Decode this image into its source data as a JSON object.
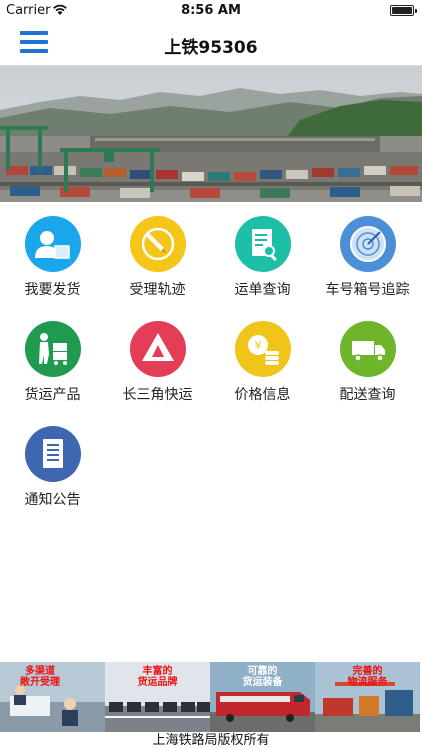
{
  "status_bar": {
    "carrier": "Carrier",
    "time": "8:56 AM"
  },
  "nav": {
    "title": "上铁95306"
  },
  "grid": [
    {
      "label": "我要发货",
      "icon": "person-box-icon",
      "color": "#1aa6ea"
    },
    {
      "label": "受理轨迹",
      "icon": "pen-circle-icon",
      "color": "#f5c518"
    },
    {
      "label": "运单查询",
      "icon": "document-search-icon",
      "color": "#1dbfa6"
    },
    {
      "label": "车号箱号追踪",
      "icon": "radar-icon",
      "color": "#4d8fd6"
    },
    {
      "label": "货运产品",
      "icon": "porter-cart-icon",
      "color": "#1f9a4e"
    },
    {
      "label": "长三角快运",
      "icon": "triangle-logo-icon",
      "color": "#e33d57"
    },
    {
      "label": "价格信息",
      "icon": "coins-icon",
      "color": "#f0c419"
    },
    {
      "label": "配送查询",
      "icon": "truck-icon",
      "color": "#6fb52c"
    },
    {
      "label": "通知公告",
      "icon": "notice-document-icon",
      "color": "#3f66b0"
    }
  ],
  "ads": [
    {
      "line1": "多渠道",
      "line2": "敞开受理"
    },
    {
      "line1": "丰富的",
      "line2": "货运品牌"
    },
    {
      "line1": "可靠的",
      "line2": "货运装备"
    },
    {
      "line1": "完善的",
      "line2": "物流服务"
    }
  ],
  "footer": {
    "copyright": "上海铁路局版权所有"
  }
}
